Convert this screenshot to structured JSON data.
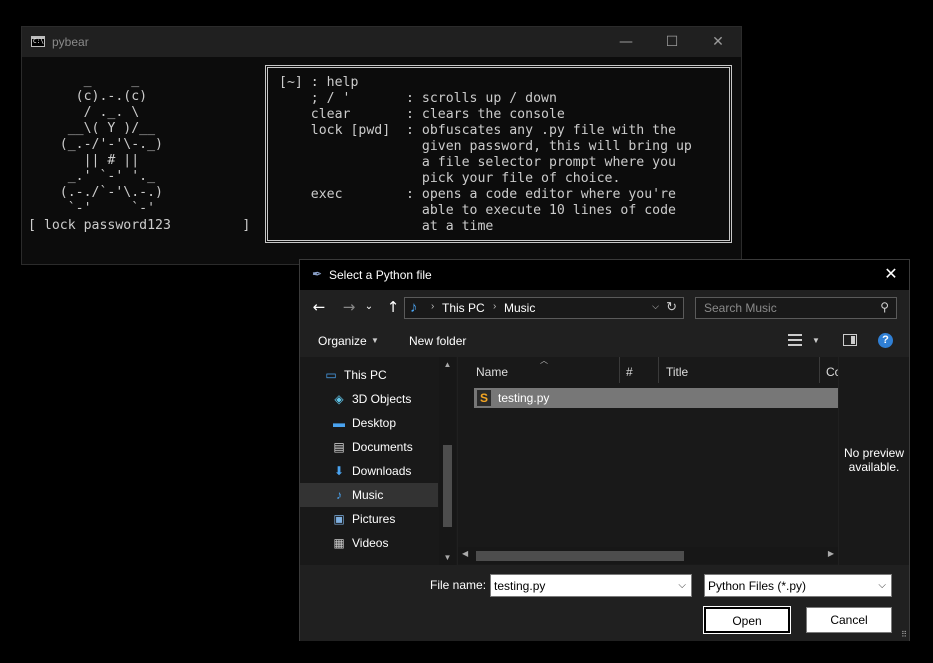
{
  "console": {
    "title": "pybear",
    "controls": {
      "minimize": "—",
      "maximize": "☐",
      "close": "✕"
    },
    "ascii_art": "       _     _\n      (c).-.(c)\n       / ._. \\\n     __\\( Y )/__\n    (_.-/'-'\\-._)\n       || # ||\n     _.' `-' '._\n    (.-./`-'\\.-.)\n     `-'     `-'",
    "prompt": "[ lock password123         ]",
    "help_text": "[~] : help\n    ; / '       : scrolls up / down\n    clear       : clears the console\n    lock [pwd]  : obfuscates any .py file with the\n                  given password, this will bring up\n                  a file selector prompt where you\n                  pick your file of choice.\n    exec        : opens a code editor where you're\n                  able to execute 10 lines of code\n                  at a time"
  },
  "dialog": {
    "title": "Select a Python file",
    "close": "✕",
    "nav": {
      "back": "←",
      "forward": "→",
      "recent": "⌄",
      "up": "↑"
    },
    "breadcrumb": [
      "This PC",
      "Music"
    ],
    "breadcrumb_sep": "›",
    "search_placeholder": "Search Music",
    "toolbar": {
      "organize": "Organize",
      "new_folder": "New folder",
      "help": "?"
    },
    "nav_pane": [
      {
        "label": "This PC",
        "icon": "this-pc-icon"
      },
      {
        "label": "3D Objects",
        "icon": "3d-objects-icon"
      },
      {
        "label": "Desktop",
        "icon": "desktop-icon"
      },
      {
        "label": "Documents",
        "icon": "documents-icon"
      },
      {
        "label": "Downloads",
        "icon": "downloads-icon"
      },
      {
        "label": "Music",
        "icon": "music-icon",
        "selected": true
      },
      {
        "label": "Pictures",
        "icon": "pictures-icon"
      },
      {
        "label": "Videos",
        "icon": "videos-icon"
      }
    ],
    "columns": [
      "Name",
      "#",
      "Title",
      "Co"
    ],
    "files": [
      {
        "name": "testing.py",
        "icon": "python-file-icon"
      }
    ],
    "preview_text": "No preview available.",
    "file_name_label": "File name:",
    "file_name_value": "testing.py",
    "file_type_value": "Python Files (*.py)",
    "open_label": "Open",
    "cancel_label": "Cancel"
  },
  "colors": {
    "console_bg": "#0c0c0c",
    "dialog_bg": "#202020",
    "selection": "#777777",
    "accent": "#2f7fd4"
  }
}
